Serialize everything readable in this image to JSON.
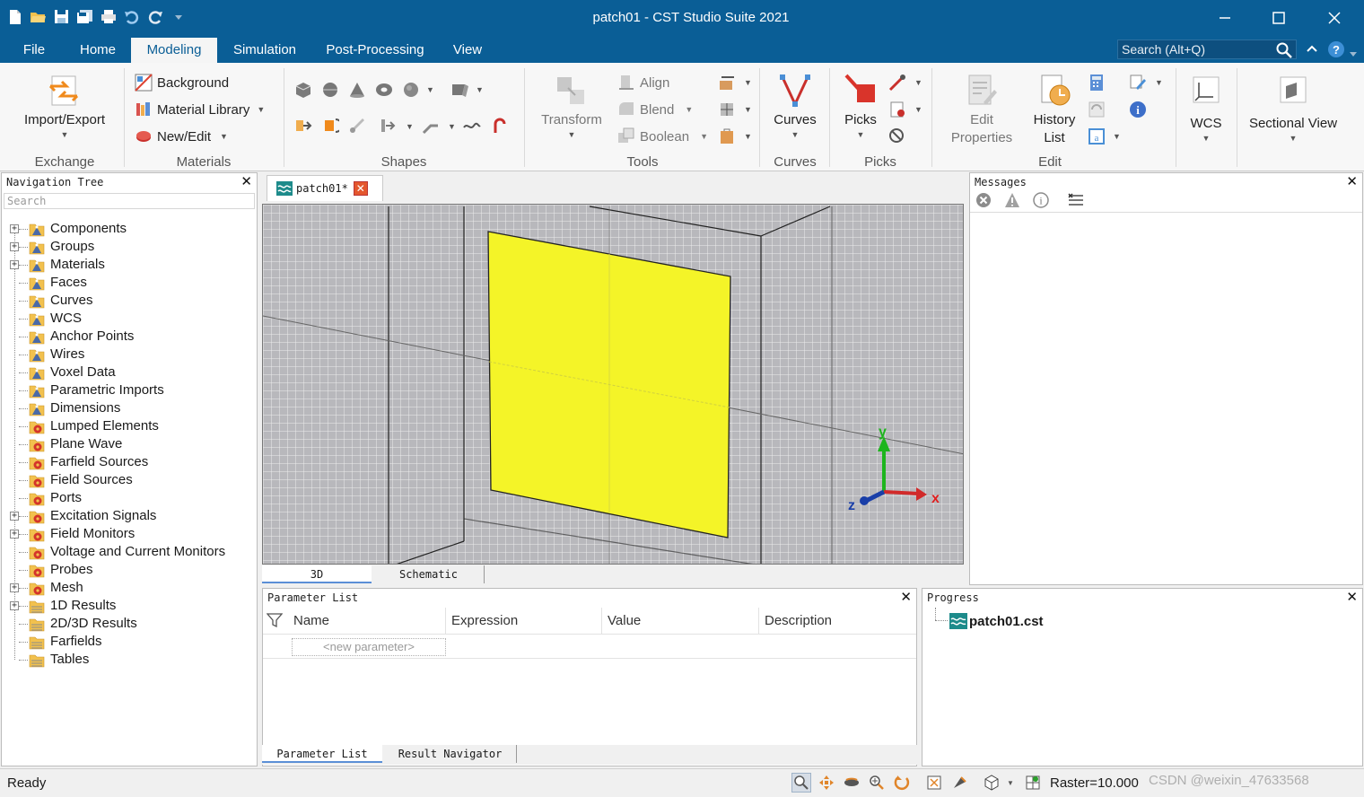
{
  "window": {
    "title": "patch01 - CST Studio Suite 2021",
    "menu_tabs": [
      "File",
      "Home",
      "Modeling",
      "Simulation",
      "Post-Processing",
      "View"
    ],
    "active_tab": "Modeling",
    "search_placeholder": "Search (Alt+Q)"
  },
  "ribbon": {
    "exchange": {
      "import_export": "Import/Export",
      "label": "Exchange"
    },
    "materials": {
      "background": "Background",
      "material_library": "Material Library",
      "new_edit": "New/Edit",
      "label": "Materials"
    },
    "shapes": {
      "label": "Shapes"
    },
    "tools": {
      "transform": "Transform",
      "align": "Align",
      "blend": "Blend",
      "boolean": "Boolean",
      "label": "Tools"
    },
    "curves": {
      "curves": "Curves",
      "label": "Curves"
    },
    "picks": {
      "picks": "Picks",
      "label": "Picks"
    },
    "edit": {
      "edit_properties_1": "Edit",
      "edit_properties_2": "Properties",
      "history_list_1": "History",
      "history_list_2": "List",
      "label": "Edit"
    },
    "wcs": {
      "wcs": "WCS"
    },
    "sectional": {
      "sectional_view": "Sectional View"
    }
  },
  "navigation_tree": {
    "title": "Navigation Tree",
    "search_placeholder": "Search",
    "items": [
      {
        "label": "Components",
        "expand": true,
        "icon": "folder-bulb-icon"
      },
      {
        "label": "Groups",
        "expand": true,
        "icon": "folder-bulb-icon"
      },
      {
        "label": "Materials",
        "expand": true,
        "icon": "folder-bulb-icon"
      },
      {
        "label": "Faces",
        "expand": false,
        "icon": "folder-bulb-icon"
      },
      {
        "label": "Curves",
        "expand": false,
        "icon": "folder-bulb-icon"
      },
      {
        "label": "WCS",
        "expand": false,
        "icon": "folder-bulb-icon"
      },
      {
        "label": "Anchor Points",
        "expand": false,
        "icon": "folder-bulb-icon"
      },
      {
        "label": "Wires",
        "expand": false,
        "icon": "folder-bulb-icon"
      },
      {
        "label": "Voxel Data",
        "expand": false,
        "icon": "folder-bulb-icon"
      },
      {
        "label": "Parametric Imports",
        "expand": false,
        "icon": "folder-bulb-icon"
      },
      {
        "label": "Dimensions",
        "expand": false,
        "icon": "folder-bulb-icon"
      },
      {
        "label": "Lumped Elements",
        "expand": false,
        "icon": "folder-gear-icon"
      },
      {
        "label": "Plane Wave",
        "expand": false,
        "icon": "folder-gear-icon"
      },
      {
        "label": "Farfield Sources",
        "expand": false,
        "icon": "folder-gear-icon"
      },
      {
        "label": "Field Sources",
        "expand": false,
        "icon": "folder-gear-icon"
      },
      {
        "label": "Ports",
        "expand": false,
        "icon": "folder-gear-icon"
      },
      {
        "label": "Excitation Signals",
        "expand": true,
        "icon": "folder-gear-icon"
      },
      {
        "label": "Field Monitors",
        "expand": true,
        "icon": "folder-gear-icon"
      },
      {
        "label": "Voltage and Current Monitors",
        "expand": false,
        "icon": "folder-gear-icon"
      },
      {
        "label": "Probes",
        "expand": false,
        "icon": "folder-gear-icon"
      },
      {
        "label": "Mesh",
        "expand": true,
        "icon": "folder-gear-icon"
      },
      {
        "label": "1D Results",
        "expand": true,
        "icon": "folder-results-icon"
      },
      {
        "label": "2D/3D Results",
        "expand": false,
        "icon": "folder-results-icon"
      },
      {
        "label": "Farfields",
        "expand": false,
        "icon": "folder-results-icon"
      },
      {
        "label": "Tables",
        "expand": false,
        "icon": "folder-results-icon"
      }
    ]
  },
  "document_tab": {
    "label": "patch01*"
  },
  "viewport": {
    "axes": {
      "x": "x",
      "y": "y",
      "z": "z"
    },
    "patch_color": "#f4f428",
    "background_color": "#b8b8bc",
    "tabs": [
      "3D",
      "Schematic"
    ],
    "active_tab": "3D"
  },
  "messages": {
    "title": "Messages"
  },
  "parameter_list": {
    "title": "Parameter List",
    "columns": [
      "Name",
      "Expression",
      "Value",
      "Description"
    ],
    "new_parameter_placeholder": "<new parameter>",
    "bottom_tabs": [
      "Parameter List",
      "Result Navigator"
    ]
  },
  "progress": {
    "title": "Progress",
    "file": "patch01.cst"
  },
  "status": {
    "text": "Ready",
    "raster": "Raster=10.000",
    "watermark": "CSDN @weixin_47633568"
  }
}
